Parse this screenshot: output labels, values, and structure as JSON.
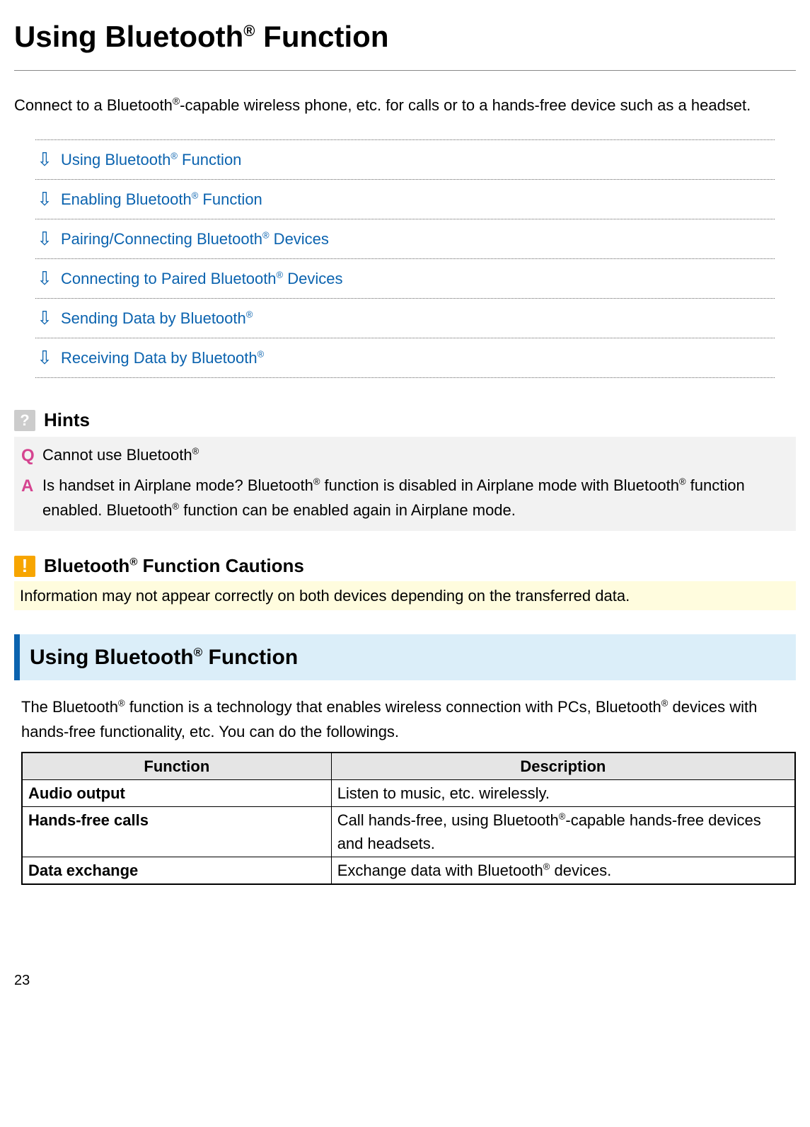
{
  "page": {
    "title_pre": "Using Bluetooth",
    "title_post": " Function",
    "reg": "®",
    "number": "23"
  },
  "intro": {
    "pre": "Connect to a Bluetooth",
    "post": "-capable wireless phone, etc. for calls or to a hands-free device such as a headset."
  },
  "toc": [
    {
      "pre": "Using Bluetooth",
      "post": " Function"
    },
    {
      "pre": "Enabling Bluetooth",
      "post": " Function"
    },
    {
      "pre": "Pairing/Connecting Bluetooth",
      "post": " Devices"
    },
    {
      "pre": "Connecting to Paired Bluetooth",
      "post": " Devices"
    },
    {
      "pre": "Sending Data by Bluetooth",
      "post": ""
    },
    {
      "pre": "Receiving Data by Bluetooth",
      "post": ""
    }
  ],
  "hints": {
    "title": "Hints",
    "q_pre": "Cannot use Bluetooth",
    "a1": "Is handset in Airplane mode? Bluetooth",
    "a2": " function is disabled in Airplane mode with Bluetooth",
    "a3": " function enabled. Bluetooth",
    "a4": " function can be enabled again in Airplane mode."
  },
  "caution": {
    "title_pre": "Bluetooth",
    "title_post": " Function Cautions",
    "body": "Information may not appear correctly on both devices depending on the transferred data."
  },
  "section": {
    "bar_pre": "Using Bluetooth",
    "bar_post": " Function",
    "body1": "The Bluetooth",
    "body2": " function is a technology that enables wireless connection with PCs, Bluetooth",
    "body3": " devices with hands-free functionality, etc. You can do the followings."
  },
  "table": {
    "h1": "Function",
    "h2": "Description",
    "rows": [
      {
        "fn": "Audio output",
        "desc_pre": "Listen to music, etc. wirelessly.",
        "desc_sup": "",
        "desc_post": ""
      },
      {
        "fn": "Hands-free calls",
        "desc_pre": "Call hands-free, using Bluetooth",
        "desc_sup": "®",
        "desc_post": "-capable hands-free devices and headsets."
      },
      {
        "fn": "Data exchange",
        "desc_pre": "Exchange data with Bluetooth",
        "desc_sup": "®",
        "desc_post": " devices."
      }
    ]
  }
}
